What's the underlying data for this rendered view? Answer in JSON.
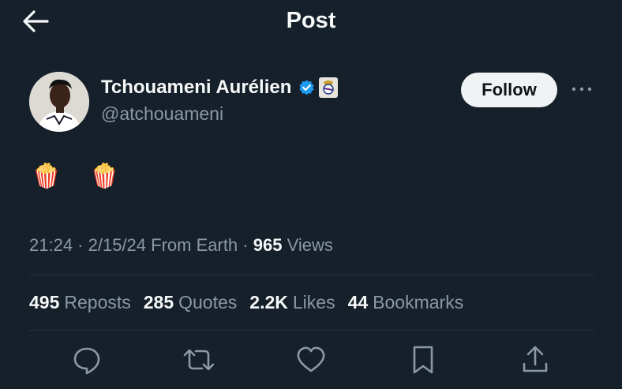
{
  "header": {
    "title": "Post",
    "back_icon": "arrow-left-icon"
  },
  "author": {
    "name": "Tchouameni Aurélien",
    "handle": "@atchouameni",
    "verified_icon": "verified-badge-icon",
    "affiliation_icon": "real-madrid-crest-icon",
    "verified_color": "#1d9bf0"
  },
  "follow_label": "Follow",
  "more_icon": "more-horizontal-icon",
  "post": {
    "text": "🍿 🍿"
  },
  "meta": {
    "time": "21:24",
    "sep1": " · ",
    "date": "2/15/24",
    "source": " From Earth",
    "sep2": " · ",
    "views_count": "965",
    "views_label": " Views"
  },
  "stats": [
    {
      "count": "495",
      "label": "Reposts"
    },
    {
      "count": "285",
      "label": "Quotes"
    },
    {
      "count": "2.2K",
      "label": "Likes"
    },
    {
      "count": "44",
      "label": "Bookmarks"
    }
  ],
  "actions": [
    "reply-icon",
    "repost-icon",
    "like-icon",
    "bookmark-icon",
    "share-icon"
  ],
  "colors": {
    "background": "#15202b",
    "text": "#f7f9f9",
    "secondary": "#8b98a5",
    "icon": "#8b98a5"
  }
}
